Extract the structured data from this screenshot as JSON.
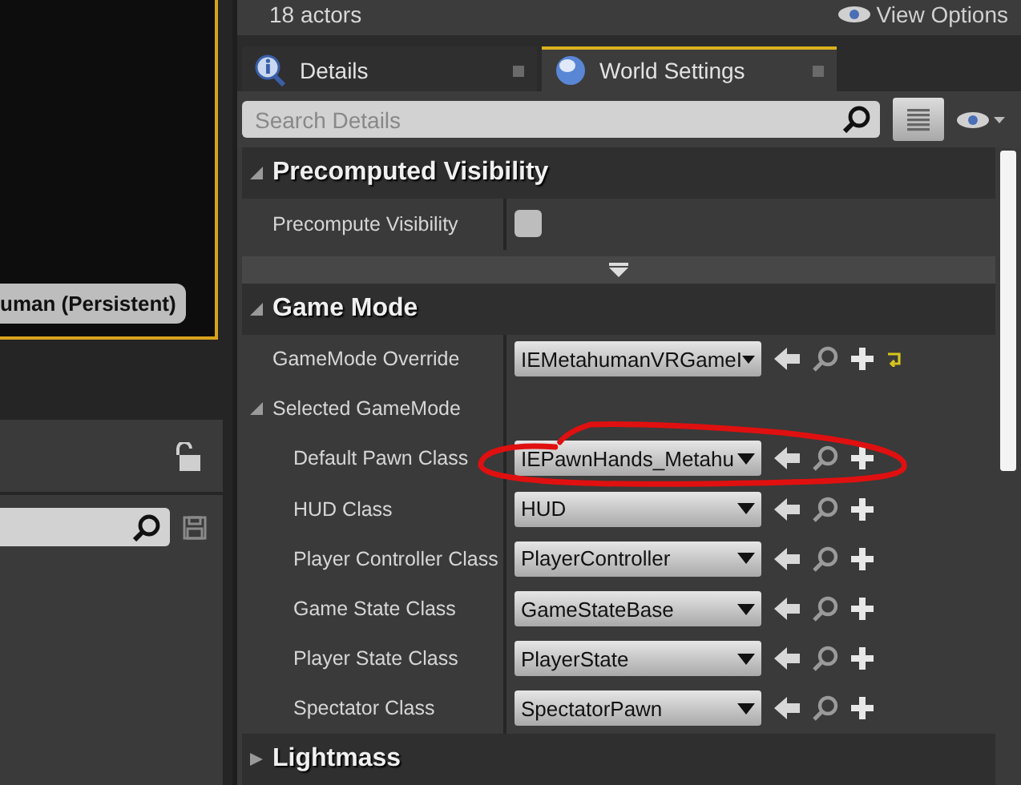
{
  "level_viewport": {
    "level_label": "uman (Persistent)"
  },
  "outliner": {
    "locked": false
  },
  "header": {
    "actor_count": "18 actors",
    "view_options": "View Options"
  },
  "tabs": [
    {
      "label": "Details",
      "selected": false
    },
    {
      "label": "World Settings",
      "selected": true
    }
  ],
  "search": {
    "placeholder": "Search Details"
  },
  "sections": [
    {
      "title": "Precomputed Visibility",
      "expanded": true,
      "rows": [
        {
          "kind": "checkbox",
          "label": "Precompute Visibility",
          "checked": false
        }
      ],
      "advanced_toggle": true
    },
    {
      "title": "Game Mode",
      "expanded": true,
      "rows": [
        {
          "kind": "class",
          "label": "GameMode Override",
          "value": "IEMetahumanVRGameI",
          "reset": true
        },
        {
          "kind": "group",
          "label": "Selected GameMode",
          "expanded": true,
          "children": [
            {
              "kind": "class",
              "label": "Default Pawn Class",
              "value": "IEPawnHands_Metahu"
            },
            {
              "kind": "class",
              "label": "HUD Class",
              "value": "HUD"
            },
            {
              "kind": "class",
              "label": "Player Controller Class",
              "value": "PlayerController"
            },
            {
              "kind": "class",
              "label": "Game State Class",
              "value": "GameStateBase"
            },
            {
              "kind": "class",
              "label": "Player State Class",
              "value": "PlayerState"
            },
            {
              "kind": "class",
              "label": "Spectator Class",
              "value": "SpectatorPawn"
            }
          ]
        }
      ]
    },
    {
      "title": "Lightmass",
      "expanded": false
    }
  ]
}
